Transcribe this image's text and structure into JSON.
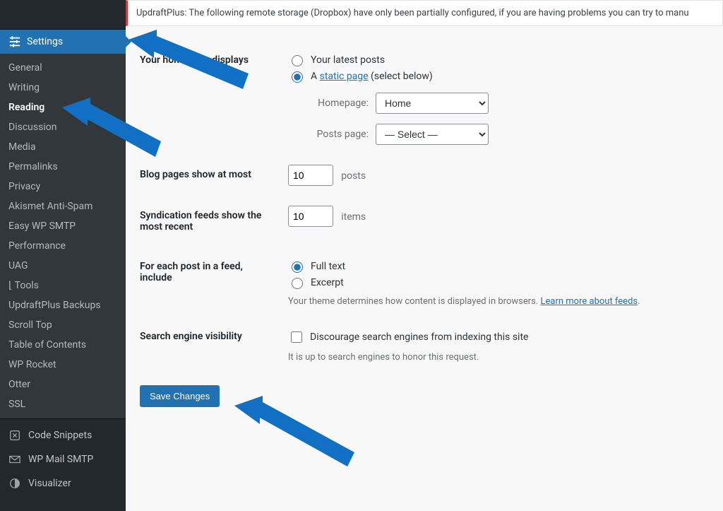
{
  "sidebar": {
    "section_label": "Settings",
    "submenu": [
      {
        "label": "General",
        "active": false
      },
      {
        "label": "Writing",
        "active": false
      },
      {
        "label": "Reading",
        "active": true
      },
      {
        "label": "Discussion",
        "active": false
      },
      {
        "label": "Media",
        "active": false
      },
      {
        "label": "Permalinks",
        "active": false
      },
      {
        "label": "Privacy",
        "active": false
      },
      {
        "label": "Akismet Anti-Spam",
        "active": false
      },
      {
        "label": "Easy WP SMTP",
        "active": false
      },
      {
        "label": "Performance",
        "active": false
      },
      {
        "label": "UAG",
        "active": false
      },
      {
        "label": "⌊  Tools",
        "active": false
      },
      {
        "label": "UpdraftPlus Backups",
        "active": false
      },
      {
        "label": "Scroll Top",
        "active": false
      },
      {
        "label": "Table of Contents",
        "active": false
      },
      {
        "label": "WP Rocket",
        "active": false
      },
      {
        "label": "Otter",
        "active": false
      },
      {
        "label": "SSL",
        "active": false
      }
    ],
    "other": [
      {
        "label": "Code Snippets"
      },
      {
        "label": "WP Mail SMTP"
      },
      {
        "label": "Visualizer"
      }
    ]
  },
  "notice": "UpdraftPlus: The following remote storage (Dropbox) have only been partially configured, if you are having problems you can try to manu",
  "form": {
    "homepage_displays": {
      "label": "Your homepage displays",
      "opt_latest": "Your latest posts",
      "opt_static_prefix": "A ",
      "opt_static_link": "static page",
      "opt_static_suffix": " (select below)",
      "selected": "static",
      "homepage_label": "Homepage:",
      "homepage_value": "Home",
      "postspage_label": "Posts page:",
      "postspage_value": "— Select —"
    },
    "blog_pages": {
      "label": "Blog pages show at most",
      "value": 10,
      "unit": "posts"
    },
    "syndication": {
      "label": "Syndication feeds show the most recent",
      "value": 10,
      "unit": "items"
    },
    "feed_include": {
      "label": "For each post in a feed, include",
      "opt_full": "Full text",
      "opt_excerpt": "Excerpt",
      "selected": "full",
      "desc_prefix": "Your theme determines how content is displayed in browsers. ",
      "desc_link": "Learn more about feeds"
    },
    "search_visibility": {
      "label": "Search engine visibility",
      "checkbox_label": "Discourage search engines from indexing this site",
      "desc": "It is up to search engines to honor this request."
    },
    "save_label": "Save Changes"
  }
}
